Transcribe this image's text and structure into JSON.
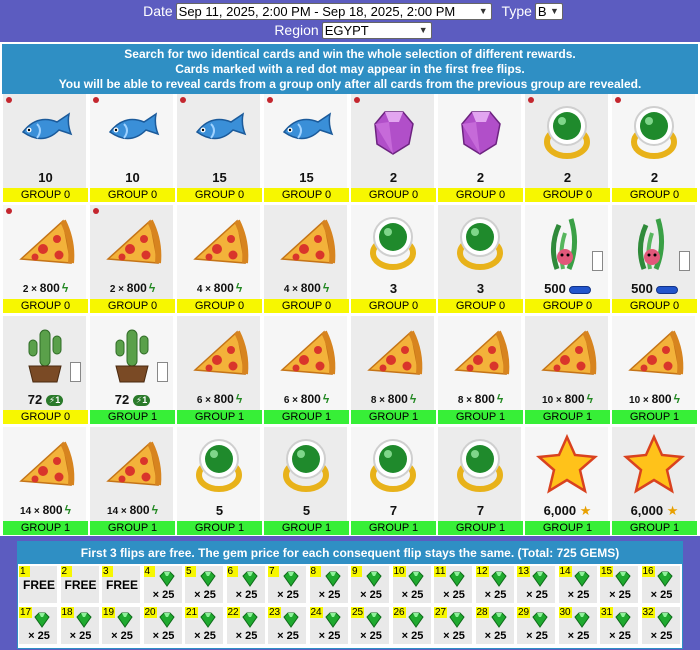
{
  "filters": {
    "date_label": "Date",
    "date_value": "Sep 11, 2025, 2:00 PM - Sep 18, 2025, 2:00 PM",
    "type_label": "Type",
    "type_value": "B",
    "region_label": "Region",
    "region_value": "EGYPT"
  },
  "notice": {
    "line1": "Search for two identical cards and win the whole selection of different rewards.",
    "line2": "Cards marked with a red dot may appear in the first free flips.",
    "line3": "You will be able to reveal cards from a group only after all cards from the previous group are revealed."
  },
  "colors": {
    "group0": "#f7f700",
    "group1": "#37ef37",
    "header_blue": "#2f8fc4",
    "background": "#5c5cc0"
  },
  "cards": [
    {
      "icon": "fish-icon",
      "value": "10",
      "group": "GROUP 0",
      "g": 0,
      "dot": true
    },
    {
      "icon": "fish-icon",
      "value": "10",
      "group": "GROUP 0",
      "g": 0,
      "dot": true
    },
    {
      "icon": "fish-icon",
      "value": "15",
      "group": "GROUP 0",
      "g": 0,
      "dot": true
    },
    {
      "icon": "fish-icon",
      "value": "15",
      "group": "GROUP 0",
      "g": 0,
      "dot": true
    },
    {
      "icon": "gem-icon",
      "value": "2",
      "group": "GROUP 0",
      "g": 0,
      "dot": true
    },
    {
      "icon": "gem-icon",
      "value": "2",
      "group": "GROUP 0",
      "g": 0,
      "dot": false
    },
    {
      "icon": "ring-icon",
      "value": "2",
      "group": "GROUP 0",
      "g": 0,
      "dot": true
    },
    {
      "icon": "ring-icon",
      "value": "2",
      "group": "GROUP 0",
      "g": 0,
      "dot": true
    },
    {
      "icon": "pizza-icon",
      "mult": "2 ×",
      "value": "800",
      "bolt": true,
      "group": "GROUP 0",
      "g": 0,
      "dot": true
    },
    {
      "icon": "pizza-icon",
      "mult": "2 ×",
      "value": "800",
      "bolt": true,
      "group": "GROUP 0",
      "g": 0,
      "dot": true
    },
    {
      "icon": "pizza-icon",
      "mult": "4 ×",
      "value": "800",
      "bolt": true,
      "group": "GROUP 0",
      "g": 0,
      "dot": false
    },
    {
      "icon": "pizza-icon",
      "mult": "4 ×",
      "value": "800",
      "bolt": true,
      "group": "GROUP 0",
      "g": 0,
      "dot": false
    },
    {
      "icon": "ring-icon",
      "value": "3",
      "group": "GROUP 0",
      "g": 0,
      "dot": false
    },
    {
      "icon": "ring-icon",
      "value": "3",
      "group": "GROUP 0",
      "g": 0,
      "dot": false
    },
    {
      "icon": "seaweed-icon",
      "value": "500",
      "pill": true,
      "check": true,
      "group": "GROUP 0",
      "g": 0,
      "dot": false
    },
    {
      "icon": "seaweed-icon",
      "value": "500",
      "pill": true,
      "check": true,
      "group": "GROUP 0",
      "g": 0,
      "dot": false
    },
    {
      "icon": "cactus-icon",
      "value": "72",
      "tag": "⚡1",
      "check": true,
      "group": "GROUP 0",
      "g": 0,
      "dot": false
    },
    {
      "icon": "cactus-icon",
      "value": "72",
      "tag": "⚡1",
      "check": true,
      "group": "GROUP 1",
      "g": 1,
      "dot": false
    },
    {
      "icon": "pizza-icon",
      "mult": "6 ×",
      "value": "800",
      "bolt": true,
      "group": "GROUP 1",
      "g": 1,
      "dot": false
    },
    {
      "icon": "pizza-icon",
      "mult": "6 ×",
      "value": "800",
      "bolt": true,
      "group": "GROUP 1",
      "g": 1,
      "dot": false
    },
    {
      "icon": "pizza-icon",
      "mult": "8 ×",
      "value": "800",
      "bolt": true,
      "group": "GROUP 1",
      "g": 1,
      "dot": false
    },
    {
      "icon": "pizza-icon",
      "mult": "8 ×",
      "value": "800",
      "bolt": true,
      "group": "GROUP 1",
      "g": 1,
      "dot": false
    },
    {
      "icon": "pizza-icon",
      "mult": "10 ×",
      "value": "800",
      "bolt": true,
      "group": "GROUP 1",
      "g": 1,
      "dot": false
    },
    {
      "icon": "pizza-icon",
      "mult": "10 ×",
      "value": "800",
      "bolt": true,
      "group": "GROUP 1",
      "g": 1,
      "dot": false
    },
    {
      "icon": "pizza-icon",
      "mult": "14 ×",
      "value": "800",
      "bolt": true,
      "group": "GROUP 1",
      "g": 1,
      "dot": false
    },
    {
      "icon": "pizza-icon",
      "mult": "14 ×",
      "value": "800",
      "bolt": true,
      "group": "GROUP 1",
      "g": 1,
      "dot": false
    },
    {
      "icon": "ring-icon",
      "value": "5",
      "group": "GROUP 1",
      "g": 1,
      "dot": false
    },
    {
      "icon": "ring-icon",
      "value": "5",
      "group": "GROUP 1",
      "g": 1,
      "dot": false
    },
    {
      "icon": "ring-icon",
      "value": "7",
      "group": "GROUP 1",
      "g": 1,
      "dot": false
    },
    {
      "icon": "ring-icon",
      "value": "7",
      "group": "GROUP 1",
      "g": 1,
      "dot": false
    },
    {
      "icon": "star-icon",
      "value": "6,000",
      "star": true,
      "group": "GROUP 1",
      "g": 1,
      "dot": false
    },
    {
      "icon": "star-icon",
      "value": "6,000",
      "star": true,
      "group": "GROUP 1",
      "g": 1,
      "dot": false
    }
  ],
  "flips": {
    "header": "First 3 flips are free. The gem price for each consequent flip stays the same. (Total: 725 GEMS)",
    "free_label": "FREE",
    "cost_label": "× 25",
    "items": [
      {
        "n": "1",
        "free": true
      },
      {
        "n": "2",
        "free": true
      },
      {
        "n": "3",
        "free": true
      },
      {
        "n": "4"
      },
      {
        "n": "5"
      },
      {
        "n": "6"
      },
      {
        "n": "7"
      },
      {
        "n": "8"
      },
      {
        "n": "9"
      },
      {
        "n": "10"
      },
      {
        "n": "11"
      },
      {
        "n": "12"
      },
      {
        "n": "13"
      },
      {
        "n": "14"
      },
      {
        "n": "15"
      },
      {
        "n": "16"
      },
      {
        "n": "17"
      },
      {
        "n": "18"
      },
      {
        "n": "19"
      },
      {
        "n": "20"
      },
      {
        "n": "21"
      },
      {
        "n": "22"
      },
      {
        "n": "23"
      },
      {
        "n": "24"
      },
      {
        "n": "25"
      },
      {
        "n": "26"
      },
      {
        "n": "27"
      },
      {
        "n": "28"
      },
      {
        "n": "29"
      },
      {
        "n": "30"
      },
      {
        "n": "31"
      },
      {
        "n": "32"
      }
    ]
  }
}
